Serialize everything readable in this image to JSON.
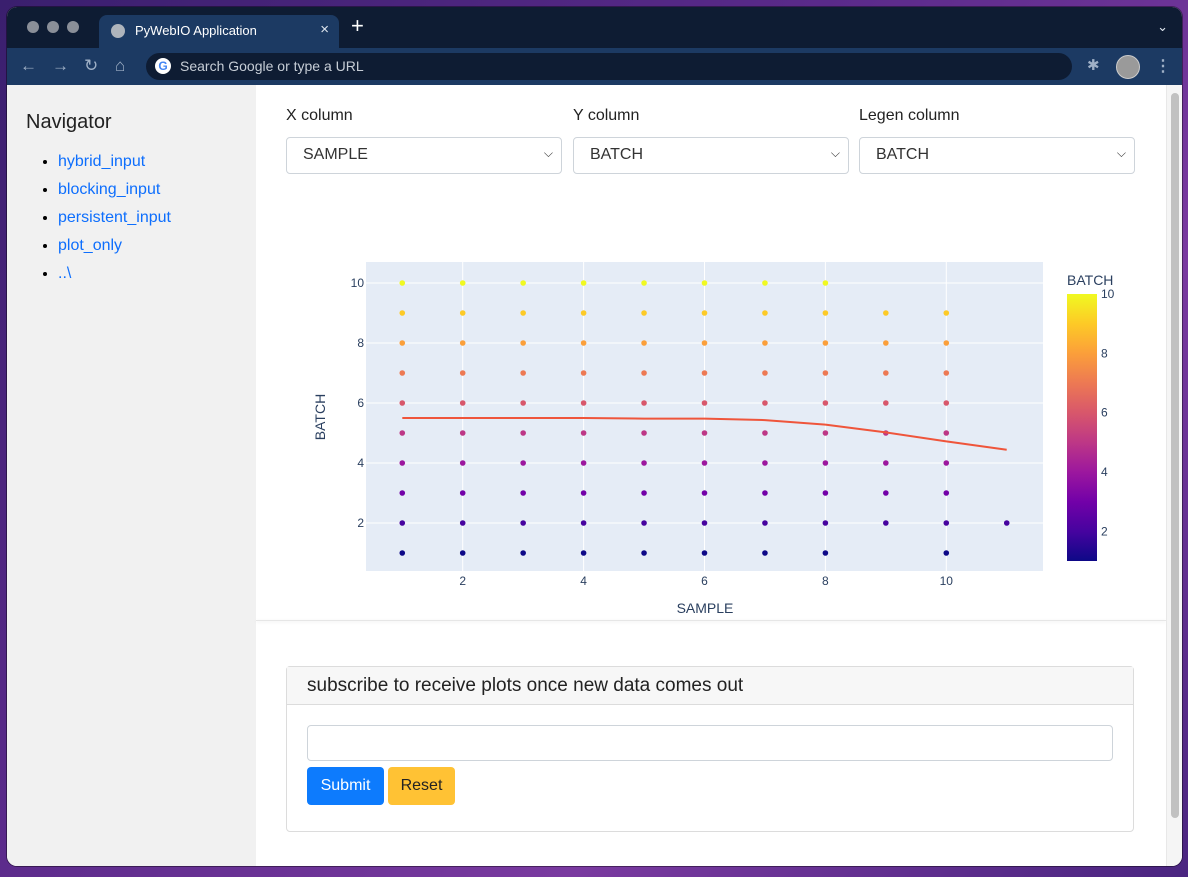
{
  "browser": {
    "tab_title": "PyWebIO Application",
    "close_glyph": "×",
    "newtab_glyph": "+",
    "address_placeholder": "Search Google or type a URL",
    "google_glyph": "G"
  },
  "sidebar": {
    "title": "Navigator",
    "items": [
      "hybrid_input",
      "blocking_input",
      "persistent_input",
      "plot_only",
      "..\\"
    ]
  },
  "controls": {
    "x_label": "X column",
    "y_label": "Y column",
    "legend_label": "Legen column",
    "x_value": "SAMPLE",
    "y_value": "BATCH",
    "legend_value": "BATCH"
  },
  "chart_data": {
    "type": "scatter",
    "xlabel": "SAMPLE",
    "ylabel": "BATCH",
    "colorbar_title": "BATCH",
    "xlim": [
      0.4,
      11.6
    ],
    "ylim": [
      0.4,
      10.7
    ],
    "xticks": [
      2,
      4,
      6,
      8,
      10
    ],
    "yticks": [
      2,
      4,
      6,
      8,
      10
    ],
    "cticks": [
      2,
      4,
      6,
      8,
      10
    ],
    "grid": true,
    "colorscale": "plasma",
    "plot_bg": "#e5ecf6",
    "points_by_sample": [
      {
        "x": 1,
        "y": [
          1,
          2,
          3,
          4,
          5,
          6,
          7,
          8,
          9,
          10
        ]
      },
      {
        "x": 2,
        "y": [
          1,
          2,
          3,
          4,
          5,
          6,
          7,
          8,
          9,
          10
        ]
      },
      {
        "x": 3,
        "y": [
          1,
          2,
          3,
          4,
          5,
          6,
          7,
          8,
          9,
          10
        ]
      },
      {
        "x": 4,
        "y": [
          1,
          2,
          3,
          4,
          5,
          6,
          7,
          8,
          9,
          10
        ]
      },
      {
        "x": 5,
        "y": [
          1,
          2,
          3,
          4,
          5,
          6,
          7,
          8,
          9,
          10
        ]
      },
      {
        "x": 6,
        "y": [
          1,
          2,
          3,
          4,
          5,
          6,
          7,
          8,
          9,
          10
        ]
      },
      {
        "x": 7,
        "y": [
          1,
          2,
          3,
          4,
          5,
          6,
          7,
          8,
          9,
          10
        ]
      },
      {
        "x": 8,
        "y": [
          1,
          2,
          3,
          4,
          5,
          6,
          7,
          8,
          9,
          10
        ]
      },
      {
        "x": 9,
        "y": [
          2,
          3,
          4,
          5,
          6,
          7,
          8,
          9
        ]
      },
      {
        "x": 10,
        "y": [
          1,
          2,
          3,
          4,
          5,
          6,
          7,
          8,
          9
        ]
      },
      {
        "x": 11,
        "y": [
          2
        ]
      }
    ],
    "trend_line": {
      "color": "#ef553b",
      "x": [
        1,
        2,
        3,
        4,
        5,
        6,
        7,
        8,
        9,
        10,
        11
      ],
      "y": [
        5.5,
        5.5,
        5.5,
        5.5,
        5.48,
        5.48,
        5.43,
        5.28,
        5.02,
        4.72,
        4.44
      ]
    }
  },
  "subscribe": {
    "header": "subscribe to receive plots once new data comes out",
    "input_value": "",
    "submit_label": "Submit",
    "reset_label": "Reset"
  }
}
